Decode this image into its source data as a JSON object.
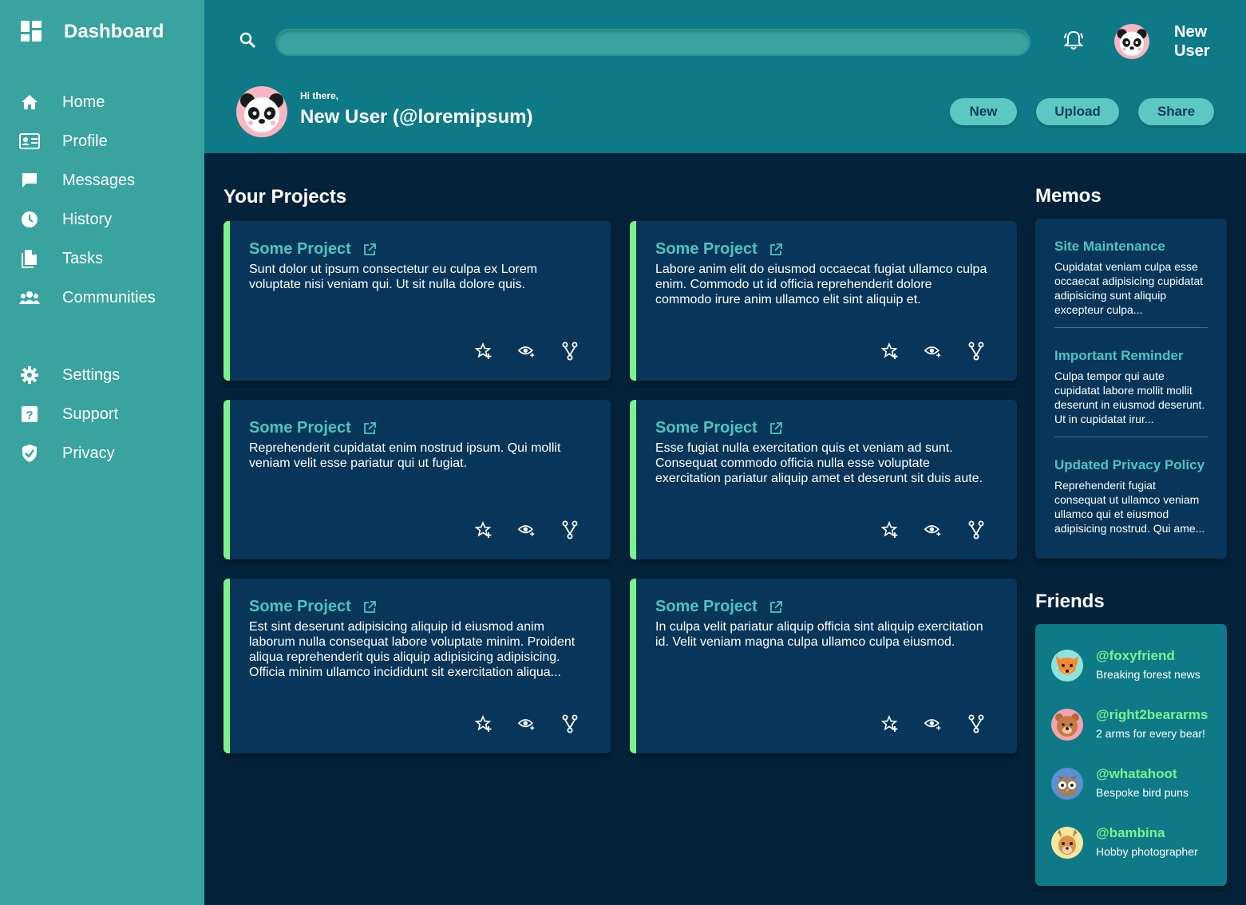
{
  "colors": {
    "sidebar": "#38a39f",
    "header": "#0e7a87",
    "background": "#04233a",
    "card": "#07365a",
    "accent_green": "#7cf28e",
    "accent_teal": "#4fc4be"
  },
  "sidebar": {
    "title": "Dashboard",
    "title_icon": "dashboard-icon",
    "items": [
      {
        "label": "Home",
        "icon": "home-icon"
      },
      {
        "label": "Profile",
        "icon": "profile-card-icon"
      },
      {
        "label": "Messages",
        "icon": "message-icon"
      },
      {
        "label": "History",
        "icon": "clock-icon"
      },
      {
        "label": "Tasks",
        "icon": "document-icon"
      },
      {
        "label": "Communities",
        "icon": "group-icon"
      }
    ],
    "secondary_items": [
      {
        "label": "Settings",
        "icon": "gear-icon"
      },
      {
        "label": "Support",
        "icon": "help-icon"
      },
      {
        "label": "Privacy",
        "icon": "shield-icon"
      }
    ]
  },
  "header": {
    "search": {
      "value": "",
      "placeholder": ""
    },
    "user_name": "New User",
    "greeting": "Hi there,",
    "full_name": "New User (@loremipsum)",
    "buttons": {
      "new": "New",
      "upload": "Upload",
      "share": "Share"
    }
  },
  "projects": {
    "title": "Your Projects",
    "items": [
      {
        "title": "Some Project",
        "description": "Sunt dolor ut ipsum consectetur eu culpa ex Lorem voluptate nisi veniam qui. Ut sit nulla dolore quis."
      },
      {
        "title": "Some Project",
        "description": "Labore anim elit do eiusmod occaecat fugiat ullamco culpa enim. Commodo ut id officia reprehenderit dolore commodo irure anim ullamco elit sint aliquip et."
      },
      {
        "title": "Some Project",
        "description": "Reprehenderit cupidatat enim nostrud ipsum. Qui mollit veniam velit esse pariatur qui ut fugiat."
      },
      {
        "title": "Some Project",
        "description": "Esse fugiat nulla exercitation quis et veniam ad sunt. Consequat commodo officia nulla esse voluptate exercitation pariatur aliquip amet et deserunt sit duis aute."
      },
      {
        "title": "Some Project",
        "description": "Est sint deserunt adipisicing aliquip id eiusmod anim laborum nulla consequat labore voluptate minim. Proident aliqua reprehenderit quis aliquip adipisicing adipisicing. Officia minim ullamco incididunt sit exercitation aliqua..."
      },
      {
        "title": "Some Project",
        "description": "In culpa velit pariatur aliquip officia sint aliquip exercitation id. Velit veniam magna culpa ullamco culpa eiusmod."
      }
    ]
  },
  "memos": {
    "title": "Memos",
    "items": [
      {
        "title": "Site Maintenance",
        "text": "Cupidatat veniam culpa esse occaecat adipisicing cupidatat adipisicing sunt aliquip excepteur culpa..."
      },
      {
        "title": "Important Reminder",
        "text": "Culpa tempor qui aute cupidatat labore mollit mollit deserunt in eiusmod deserunt. Ut in cupidatat irur..."
      },
      {
        "title": "Updated Privacy Policy",
        "text": "Reprehenderit fugiat consequat ut ullamco veniam ullamco qui et eiusmod adipisicing nostrud. Qui ame..."
      }
    ]
  },
  "friends": {
    "title": "Friends",
    "items": [
      {
        "handle": "@foxyfriend",
        "status": "Breaking forest news",
        "avatar": "fox-avatar-icon"
      },
      {
        "handle": "@right2beararms",
        "status": "2 arms for every bear!",
        "avatar": "bear-avatar-icon"
      },
      {
        "handle": "@whatahoot",
        "status": "Bespoke bird puns",
        "avatar": "owl-avatar-icon"
      },
      {
        "handle": "@bambina",
        "status": "Hobby photographer",
        "avatar": "deer-avatar-icon"
      }
    ]
  }
}
